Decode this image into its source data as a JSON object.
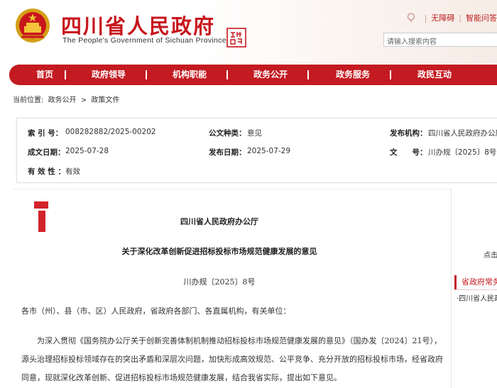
{
  "header": {
    "title": "四川省人民政府",
    "subtitle": "The People's Government of Sichuan Province",
    "emblem_icon": "national-emblem-icon",
    "seal_icon": "sichuan-seal-icon",
    "top_links": [
      "无障碍",
      "智能问答"
    ],
    "top_link_icon": "accessibility-pin-icon",
    "search_placeholder": "请输入搜索内容",
    "brand_color": "#c41a21"
  },
  "nav": {
    "items": [
      "首页",
      "政府领导",
      "机构职能",
      "政务公开",
      "政务服务",
      "政民互动"
    ]
  },
  "breadcrumb": {
    "label": "当前位置:",
    "items": [
      "政务公开",
      "政策文件"
    ],
    "separator": ">"
  },
  "info": {
    "index_label": "索 引 号：",
    "index_value": "008282882/2025-00202",
    "category_label": "公文种类：",
    "category_value": "意见",
    "issuer_label": "发布机构：",
    "issuer_value": "四川省人民政府办公厅",
    "created_label": "成文日期：",
    "created_value": "2025-07-28",
    "published_label": "发布日期：",
    "published_value": "2025-07-29",
    "docno_label": "文　　号：",
    "docno_value": "川办规〔2025〕8号",
    "validity_label": "有 效 性 ：",
    "validity_value": "有效"
  },
  "article": {
    "org": "四川省人民政府办公厅",
    "title": "关于深化改革创新促进招标投标市场规范健康发展的意见",
    "doc_number": "川办规〔2025〕8号",
    "salutation": "各市（州）、县（市、区）人民政府，省政府各部门、各直属机构，有关单位：",
    "paragraph": "为深入贯彻《国务院办公厅关于创新完善体制机制推动招标投标市场规范健康发展的意见》（国办发〔2024〕21号），源头治理招标投标领域存在的突出矛盾和深层次问题，加快形成高效规范、公平竞争、充分开放的招标投标市场，经省政府同意，现就深化改革创新、促进招标投标市场规范健康发展，结合我省实际，提出如下意见。"
  },
  "sidebar": {
    "click_text": "点击",
    "section_title": "省政府常务",
    "link": "·四川省人民政府"
  }
}
